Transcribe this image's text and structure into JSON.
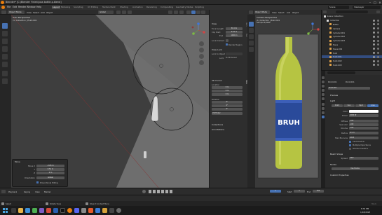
{
  "window": {
    "title": "Blender* [C:\\Blender Finish\\juss bottle.p.blend]",
    "controls": [
      "–",
      "□",
      "×"
    ]
  },
  "menu": {
    "items": [
      "File",
      "Edit",
      "Render",
      "Window",
      "Help"
    ],
    "workspaces": [
      "Layout",
      "Modeling",
      "Sculpting",
      "UV Editing",
      "Texture Paint",
      "Shading",
      "Animation",
      "Rendering",
      "Compositing",
      "Geometry Nodes",
      "Scripting"
    ],
    "active_workspace": "Layout",
    "scene": "Scene",
    "view_layer": "ViewLayer"
  },
  "viewport": {
    "mode": "Object Mode",
    "menus": [
      "View",
      "Select",
      "Add",
      "Object"
    ],
    "transform": "Global",
    "overlay_title": "User Perspective",
    "overlay_sub": "(1) Collection | Point.001"
  },
  "npanel": {
    "tabs": [
      "Item",
      "Tool",
      "View"
    ],
    "view_section": "View",
    "focal_length_label": "Focal Length",
    "focal_length": "50 mm",
    "clip_start_label": "Clip Start",
    "clip_start": "0.01 m",
    "clip_end_label": "End",
    "clip_end": "1000 m",
    "local_camera_label": "Local Camera",
    "render_region_label": "Render Region",
    "view_lock_section": "View Lock",
    "lock_to_object_label": "Lock to Object",
    "lock_label": "Lock",
    "lock_value": "To 3D Cursor",
    "cursor_section": "3D Cursor",
    "location_label": "Location",
    "cursor_x": "0 m",
    "cursor_y": "0 m",
    "cursor_z": "0 m",
    "rotation_label": "Rotation",
    "rot_x": "0°",
    "rot_y": "0°",
    "rot_z": "0°",
    "rotation_mode": "XYZ Euler",
    "collections_section": "Collections",
    "annotations_section": "Annotations"
  },
  "camera_view": {
    "mode": "Object Mode",
    "menus": [
      "View",
      "Select",
      "Add",
      "Object"
    ],
    "overlay_title": "Camera Perspective",
    "overlay_sub": "(1) Collection | Point.001",
    "overlay_sub2": "Sample 8/4096",
    "label_text": "BRUH",
    "glass_color": "#b6c442",
    "label_color": "#2a4a9a"
  },
  "outliner": {
    "title": "Scene Collection",
    "rows": [
      {
        "name": "Scene Collection",
        "indent": 0,
        "selected": false
      },
      {
        "name": "Collection",
        "indent": 1,
        "selected": false
      },
      {
        "name": "Bottle",
        "indent": 2,
        "selected": false
      },
      {
        "name": "Camera",
        "indent": 2,
        "selected": false
      },
      {
        "name": "Cylinder.001",
        "indent": 2,
        "selected": false
      },
      {
        "name": "Cylinder.002",
        "indent": 2,
        "selected": false
      },
      {
        "name": "Cylinder.003",
        "indent": 2,
        "selected": false
      },
      {
        "name": "Plane",
        "indent": 2,
        "selected": false
      },
      {
        "name": "Plane.001",
        "indent": 2,
        "selected": false
      },
      {
        "name": "Point",
        "indent": 2,
        "selected": false
      },
      {
        "name": "Point.001",
        "indent": 2,
        "selected": true
      },
      {
        "name": "Point.002",
        "indent": 2,
        "selected": false
      },
      {
        "name": "Point.003",
        "indent": 2,
        "selected": false
      }
    ]
  },
  "properties": {
    "breadcrumb_a": "Point.001",
    "breadcrumb_b": "Point.001",
    "name_field": "Point.001",
    "preview_section": "Preview",
    "light_section": "Light",
    "light_types": [
      "Point",
      "Sun",
      "Spot",
      "Area"
    ],
    "active_light_type": "Point",
    "color_label": "Color",
    "power_label": "Power",
    "power": "1000 W",
    "diffuse_label": "Diffuse",
    "diffuse": "1.00",
    "specular_label": "Specular",
    "specular": "1.00",
    "volume_label": "Volume",
    "volume": "1.00",
    "radius_label": "Radius",
    "radius": "0.1 m",
    "max_bounces_label": "Max Bounces",
    "max_bounces": "1024",
    "cast_shadow_label": "Cast Shadow",
    "multiple_importance_label": "Multiple Importance",
    "shadow_caustics_label": "Shadow Caustics",
    "beam_shape_section": "Beam Shape",
    "spread_label": "Spread",
    "spread": "180°",
    "nodes_section": "Nodes",
    "use_nodes_label": "Use Nodes",
    "custom_props_section": "Custom Properties"
  },
  "operator_panel": {
    "title": "Move",
    "move_label": "Move X",
    "move_x": "-2.65 m",
    "y_label": "Y",
    "move_y": "0.51 m",
    "z_label": "Z",
    "move_z": "0 m",
    "orientation_label": "Orientation",
    "orientation": "Global",
    "proportional_label": "Proportional Editing"
  },
  "timeline": {
    "playback_label": "Playback",
    "keying_label": "Keying",
    "view_label": "View",
    "marker_label": "Marker",
    "current_frame": "1",
    "start_label": "Start",
    "start": "1",
    "end_label": "End",
    "end": "250"
  },
  "statusbar": {
    "select_label": "Select",
    "rotate_label": "Rotate View",
    "menu_label": "Object Context Menu",
    "version": "3.4.1"
  },
  "taskbar": {
    "time": "8:32 PM",
    "date": "1/18/2023"
  },
  "colors": {
    "accent": "#4772b3",
    "selection": "#334d80",
    "background": "#1d1d1d",
    "viewport": "#3d3d3d",
    "glass": "#b6c442",
    "label_blue": "#2a4a9a",
    "light_point_color": "#ffffff"
  }
}
